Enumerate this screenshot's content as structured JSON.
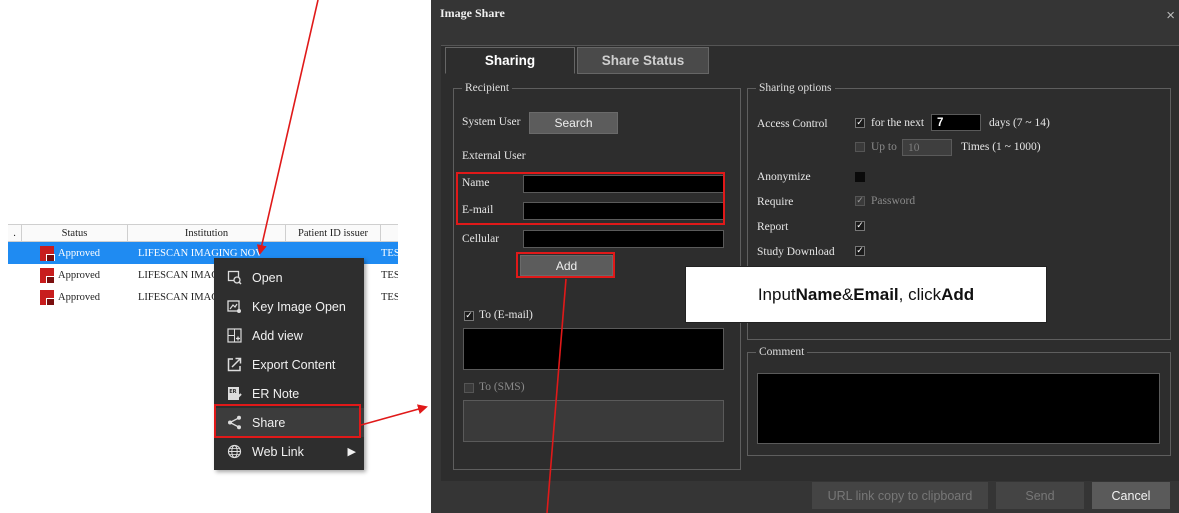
{
  "worklist": {
    "columns": [
      "Status",
      "Institution",
      "Patient ID issuer"
    ],
    "first_col_fragment": ".",
    "rows": [
      {
        "status": "Approved",
        "institution": "LIFESCAN IMAGING NOV",
        "extra": "TES"
      },
      {
        "status": "Approved",
        "institution": "LIFESCAN IMAGI",
        "extra": "TES"
      },
      {
        "status": "Approved",
        "institution": "LIFESCAN IMAGI",
        "extra": "TES"
      }
    ]
  },
  "context_menu": {
    "items": [
      {
        "label": "Open",
        "icon": "open-icon"
      },
      {
        "label": "Key Image Open",
        "icon": "key-image-icon"
      },
      {
        "label": "Add view",
        "icon": "add-view-icon"
      },
      {
        "label": "Export Content",
        "icon": "export-icon"
      },
      {
        "label": "ER Note",
        "icon": "er-note-icon"
      },
      {
        "label": "Share",
        "icon": "share-icon"
      },
      {
        "label": "Web Link",
        "icon": "web-link-icon"
      }
    ]
  },
  "dialog": {
    "title": "Image Share",
    "close_glyph": "×",
    "tabs": [
      "Sharing",
      "Share Status"
    ],
    "recipient": {
      "legend": "Recipient",
      "system_user_label": "System User",
      "search_button": "Search",
      "external_user_label": "External User",
      "name_label": "Name",
      "email_label": "E-mail",
      "cellular_label": "Cellular",
      "add_button": "Add",
      "to_email_label": "To (E-mail)",
      "to_sms_label": "To (SMS)"
    },
    "sharing_options": {
      "legend": "Sharing options",
      "access_control_label": "Access Control",
      "for_next_label": "for the next",
      "days_value": "7",
      "days_range": "days (7 ~ 14)",
      "up_to_label": "Up to",
      "times_value": "10",
      "times_range": "Times (1 ~ 1000)",
      "anonymize_label": "Anonymize",
      "require_label": "Require",
      "password_label": "Password",
      "report_label": "Report",
      "study_download_label": "Study Download"
    },
    "comment": {
      "legend": "Comment"
    },
    "footer": {
      "url_button": "URL link copy to clipboard",
      "send_button": "Send",
      "cancel_button": "Cancel"
    }
  },
  "callout": {
    "prefix": "Input ",
    "name_word": "Name",
    "middle": " & ",
    "email_word": "Email",
    "comma": ", click ",
    "add_word": "Add"
  },
  "colors": {
    "highlight": "#e01919",
    "selected_row": "#1f8bf2",
    "dialog_bg": "#353535",
    "menu_bg": "#2e2e2e"
  }
}
